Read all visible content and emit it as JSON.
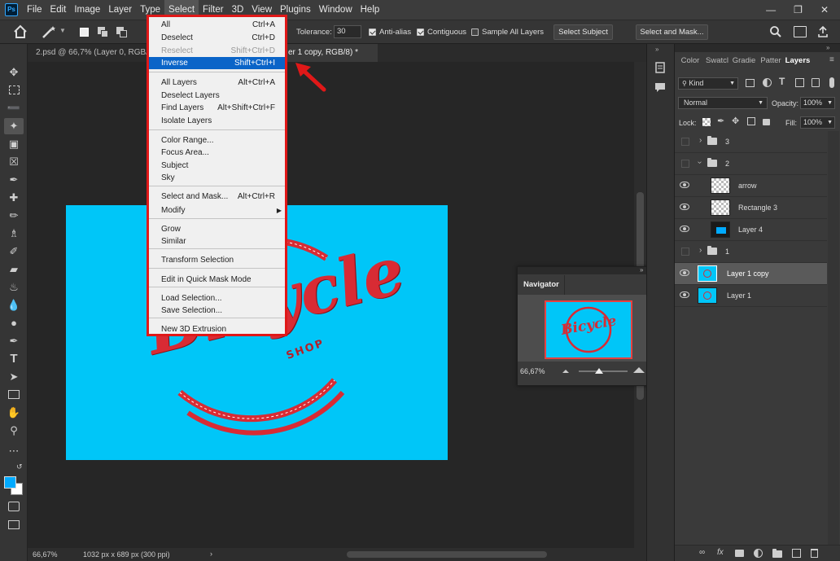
{
  "menubar": {
    "app_icon": "Ps",
    "items": [
      "File",
      "Edit",
      "Image",
      "Layer",
      "Type",
      "Select",
      "Filter",
      "3D",
      "View",
      "Plugins",
      "Window",
      "Help"
    ],
    "active_item": "Select"
  },
  "options": {
    "tolerance_label": "Tolerance:",
    "tolerance_value": "30",
    "antialias_label": "Anti-alias",
    "contiguous_label": "Contiguous",
    "sample_all_label": "Sample All Layers",
    "select_subject": "Select Subject",
    "select_and_mask": "Select and Mask..."
  },
  "tabs": {
    "tab1": "2.psd @ 66,7% (Layer 0, RGB/8)",
    "tab2": "er 1 copy, RGB/8) *",
    "tab2_close": "×"
  },
  "status": {
    "zoom": "66,67%",
    "doc_info": "1032 px x 689 px (300 ppi)"
  },
  "canvas": {
    "bg_color": "#00c6f8",
    "logo_main": "Bicycle",
    "logo_sub": "SHOP",
    "logo_color": "#d82b34"
  },
  "select_menu": {
    "items": [
      {
        "label": "All",
        "shortcut": "Ctrl+A",
        "state": "normal"
      },
      {
        "label": "Deselect",
        "shortcut": "Ctrl+D",
        "state": "normal"
      },
      {
        "label": "Reselect",
        "shortcut": "Shift+Ctrl+D",
        "state": "disabled"
      },
      {
        "label": "Inverse",
        "shortcut": "Shift+Ctrl+I",
        "state": "highlighted"
      },
      {
        "label": "All Layers",
        "shortcut": "Alt+Ctrl+A",
        "state": "normal"
      },
      {
        "label": "Deselect Layers",
        "shortcut": "",
        "state": "normal"
      },
      {
        "label": "Find Layers",
        "shortcut": "Alt+Shift+Ctrl+F",
        "state": "normal"
      },
      {
        "label": "Isolate Layers",
        "shortcut": "",
        "state": "normal"
      },
      {
        "label": "Color Range...",
        "shortcut": "",
        "state": "normal"
      },
      {
        "label": "Focus Area...",
        "shortcut": "",
        "state": "normal"
      },
      {
        "label": "Subject",
        "shortcut": "",
        "state": "normal"
      },
      {
        "label": "Sky",
        "shortcut": "",
        "state": "normal"
      },
      {
        "label": "Select and Mask...",
        "shortcut": "Alt+Ctrl+R",
        "state": "normal"
      },
      {
        "label": "Modify",
        "shortcut": "",
        "state": "submenu"
      },
      {
        "label": "Grow",
        "shortcut": "",
        "state": "normal"
      },
      {
        "label": "Similar",
        "shortcut": "",
        "state": "normal"
      },
      {
        "label": "Transform Selection",
        "shortcut": "",
        "state": "normal"
      },
      {
        "label": "Edit in Quick Mask Mode",
        "shortcut": "",
        "state": "normal"
      },
      {
        "label": "Load Selection...",
        "shortcut": "",
        "state": "normal"
      },
      {
        "label": "Save Selection...",
        "shortcut": "",
        "state": "normal"
      },
      {
        "label": "New 3D Extrusion",
        "shortcut": "",
        "state": "normal"
      }
    ]
  },
  "navigator": {
    "title": "Navigator",
    "zoom": "66,67%"
  },
  "layers_panel": {
    "tabs": [
      "Color",
      "Swatcl",
      "Gradie",
      "Patter",
      "Layers"
    ],
    "active_tab": "Layers",
    "filter_kind": "Kind",
    "blend_mode": "Normal",
    "opacity_label": "Opacity:",
    "opacity_value": "100%",
    "lock_label": "Lock:",
    "fill_label": "Fill:",
    "fill_value": "100%",
    "layers": [
      {
        "name": "3",
        "kind": "group",
        "visible": false,
        "expanded": false
      },
      {
        "name": "2",
        "kind": "group",
        "visible": false,
        "expanded": true
      },
      {
        "name": "arrow",
        "kind": "layer",
        "visible": true
      },
      {
        "name": "Rectangle 3",
        "kind": "layer",
        "visible": true
      },
      {
        "name": "Layer 4",
        "kind": "layer",
        "visible": true
      },
      {
        "name": "1",
        "kind": "group",
        "visible": false,
        "expanded": false
      },
      {
        "name": "Layer 1 copy",
        "kind": "layer",
        "visible": true,
        "selected": true
      },
      {
        "name": "Layer 1",
        "kind": "layer",
        "visible": true
      }
    ]
  },
  "colors": {
    "highlight": "#0a64c8",
    "menu_border": "#e01818",
    "foreground": "#00aaff",
    "background": "#ffffff"
  }
}
